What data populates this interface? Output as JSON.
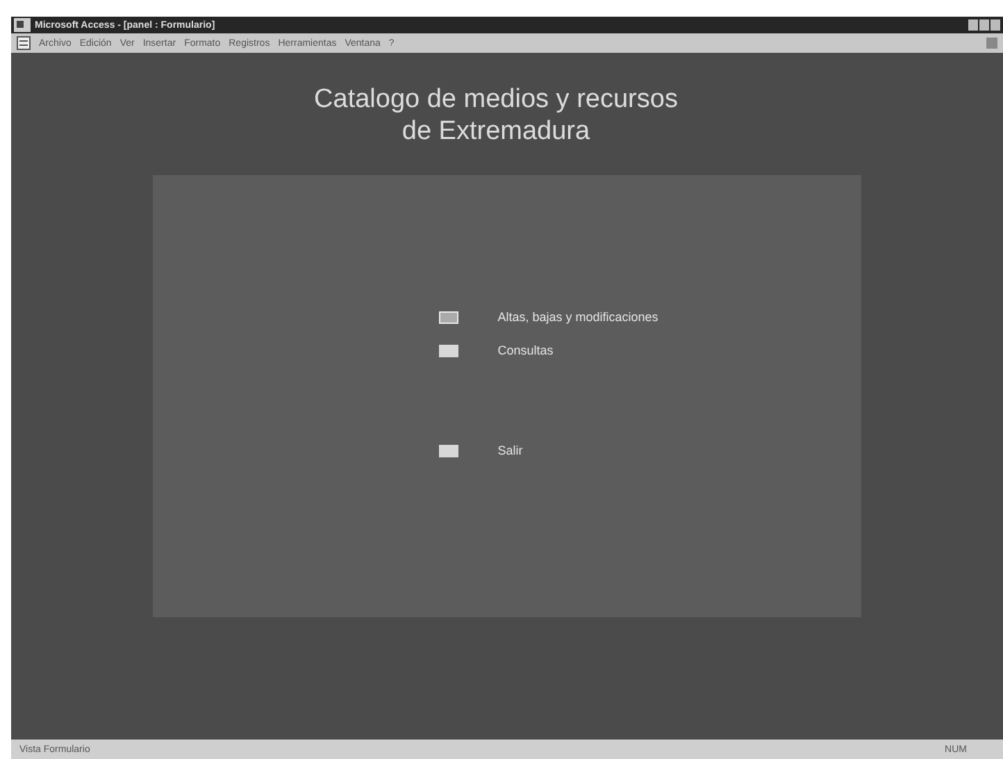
{
  "window": {
    "title": "Microsoft Access - [panel : Formulario]"
  },
  "menu": [
    "Archivo",
    "Edición",
    "Ver",
    "Insertar",
    "Formato",
    "Registros",
    "Herramientas",
    "Ventana",
    "?"
  ],
  "form": {
    "title_lines": [
      "Catalogo de medios y recursos",
      "de Extremadura"
    ],
    "options": [
      {
        "label": "Altas, bajas y modificaciones",
        "selected": true
      },
      {
        "label": "Consultas",
        "selected": false
      },
      {
        "label": "Salir",
        "selected": false
      }
    ]
  },
  "status_bar": {
    "left": "Vista Formulario",
    "right": "NUM"
  }
}
